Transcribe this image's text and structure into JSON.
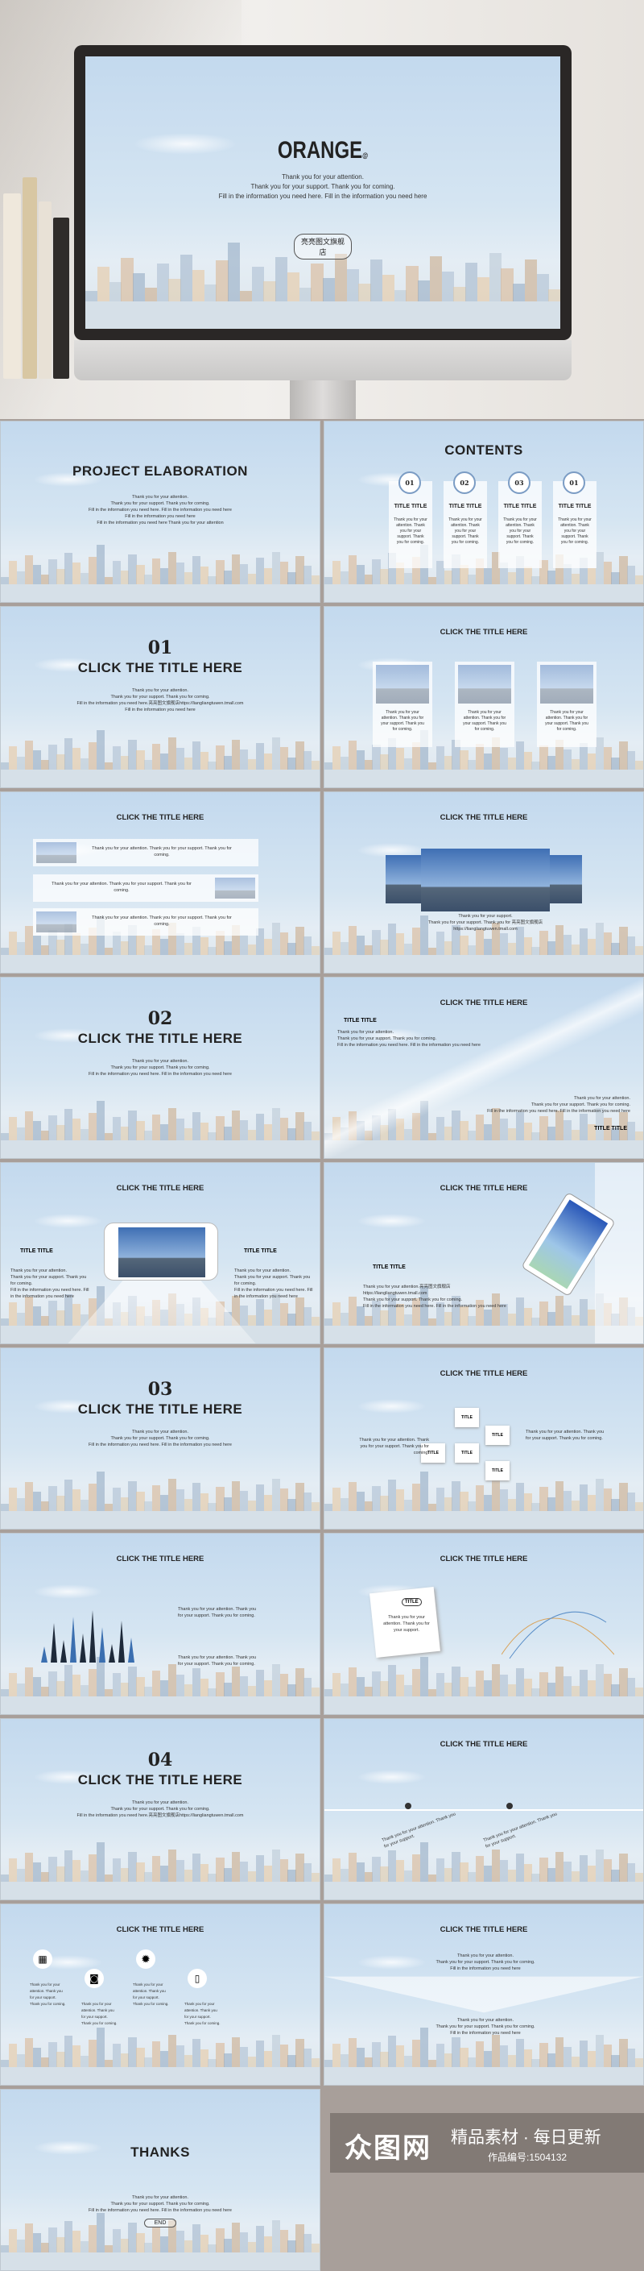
{
  "hero": {
    "title": "ORANGE",
    "title_mark": "@",
    "lines": [
      "Thank you for your attention.",
      "Thank you for your support. Thank you for coming.",
      "Fill in the information you need here. Fill in the information you need here"
    ],
    "button": "亮亮图文旗舰店"
  },
  "colors": {
    "sky": "#c3d9ee",
    "frame": "#2a2726",
    "page_bg": "#a89f9a",
    "watermark_bg": "#827a75"
  },
  "slides": [
    {
      "kind": "intro",
      "title": "PROJECT ELABORATION",
      "lines": [
        "Thank you for your attention.",
        "Thank you for your support. Thank you for coming.",
        "Fill in the information you need here. Fill in the information you need here",
        "Fill in the information you need here",
        "Fill in the information you need here Thank you for your attention"
      ]
    },
    {
      "kind": "contents",
      "title": "CONTENTS",
      "cards": [
        {
          "num": "01",
          "label": "TITLE TITLE",
          "text": "Thank you for your attention. Thank you for your support. Thank you for coming."
        },
        {
          "num": "02",
          "label": "TITLE TITLE",
          "text": "Thank you for your attention. Thank you for your support. Thank you for coming."
        },
        {
          "num": "03",
          "label": "TITLE TITLE",
          "text": "Thank you for your attention. Thank you for your support. Thank you for coming."
        },
        {
          "num": "01",
          "label": "TITLE TITLE",
          "text": "Thank you for your attention. Thank you for your support. Thank you for coming."
        }
      ]
    },
    {
      "kind": "section",
      "num": "01",
      "title": "CLICK THE TITLE HERE",
      "lines": [
        "Thank you for your attention.",
        "Thank you for your support. Thank you for coming.",
        "Fill in the information you need here.亮亮图文旗舰店https://liangliangtuwen.tmall.com",
        "Fill in the information you need here"
      ]
    },
    {
      "kind": "photocards",
      "title": "CLICK THE TITLE HERE",
      "text": "Thank you for your attention. Thank you for your support. Thank you for coming."
    },
    {
      "kind": "bars",
      "title": "CLICK THE TITLE HERE",
      "text": "Thank you for your attention. Thank you for your support. Thank you for coming."
    },
    {
      "kind": "gallery",
      "title": "CLICK THE TITLE HERE",
      "lines": [
        "Thank you for your support.",
        "Thank you for your support. Thank you for 亮亮图文旗舰店",
        "https://liangliangtuwen.tmall.com"
      ]
    },
    {
      "kind": "section",
      "num": "02",
      "title": "CLICK THE TITLE HERE",
      "lines": [
        "Thank you for your attention.",
        "Thank you for your support. Thank you for coming.",
        "Fill in the information you need here. Fill in the information you need here"
      ]
    },
    {
      "kind": "diagonal",
      "title": "CLICK THE TITLE HERE",
      "label": "TITLE TITLE",
      "lines": [
        "Thank you for your attention.",
        "Thank you for your support. Thank you for coming.",
        "Fill in the information you need here. Fill in the information you need here"
      ]
    },
    {
      "kind": "phone",
      "title": "CLICK THE TITLE HERE",
      "label": "TITLE TITLE",
      "lines": [
        "Thank you for your attention.",
        "Thank you for your support. Thank you for coming.",
        "Fill in the information you need here. Fill in the information you need here"
      ]
    },
    {
      "kind": "tablet",
      "title": "CLICK THE TITLE HERE",
      "label": "TITLE TITLE",
      "lines": [
        "Thank you for your attention.亮亮图文旗舰店",
        "https://liangliangtuwen.tmall.com",
        "Thank you for your support. Thank you for coming.",
        "Fill in the information you need here. Fill in the information you need here"
      ]
    },
    {
      "kind": "section",
      "num": "03",
      "title": "CLICK THE TITLE HERE",
      "lines": [
        "Thank you for your attention.",
        "Thank you for your support. Thank you for coming.",
        "Fill in the information you need here. Fill in the information you need here"
      ]
    },
    {
      "kind": "boxes",
      "title": "CLICK THE TITLE HERE",
      "label": "TITLE",
      "text": "Thank you for your attention. Thank you for your support. Thank you for coming."
    },
    {
      "kind": "spikes",
      "title": "CLICK THE TITLE HERE",
      "text": "Thank you for your attention. Thank you for your support. Thank you for coming."
    },
    {
      "kind": "paper",
      "title": "CLICK THE TITLE HERE",
      "label": "TITLE",
      "text": "Thank you for your attention. Thank you for your support."
    },
    {
      "kind": "section",
      "num": "04",
      "title": "CLICK THE TITLE HERE",
      "lines": [
        "Thank you for your attention.",
        "Thank you for your support. Thank you for coming.",
        "Fill in the information you need here.亮亮图文旗舰店https://liangliangtuwen.tmall.com"
      ]
    },
    {
      "kind": "timeline",
      "title": "CLICK THE TITLE HERE",
      "text": "Thank you for your attention. Thank you for your support."
    },
    {
      "kind": "icons",
      "title": "CLICK THE TITLE HERE",
      "text": "Thank you for your attention. Thank you for your support. Thank you for coming.",
      "icons": [
        "calendar-icon",
        "camera-icon",
        "gear-icon",
        "ipod-icon"
      ]
    },
    {
      "kind": "triangles",
      "title": "CLICK THE TITLE HERE",
      "lines": [
        "Thank you for your attention.",
        "Thank you for your support. Thank you for coming.",
        "Fill in the information you need here"
      ]
    },
    {
      "kind": "thanks",
      "title": "THANKS",
      "lines": [
        "Thank you for your attention.",
        "Thank you for your support. Thank you for coming.",
        "Fill in the information you need here. Fill in the information you need here"
      ],
      "button": "END"
    }
  ],
  "watermark": {
    "logo": "众图网",
    "slogan": "精品素材 · 每日更新",
    "id_label": "作品编号:1504132"
  }
}
